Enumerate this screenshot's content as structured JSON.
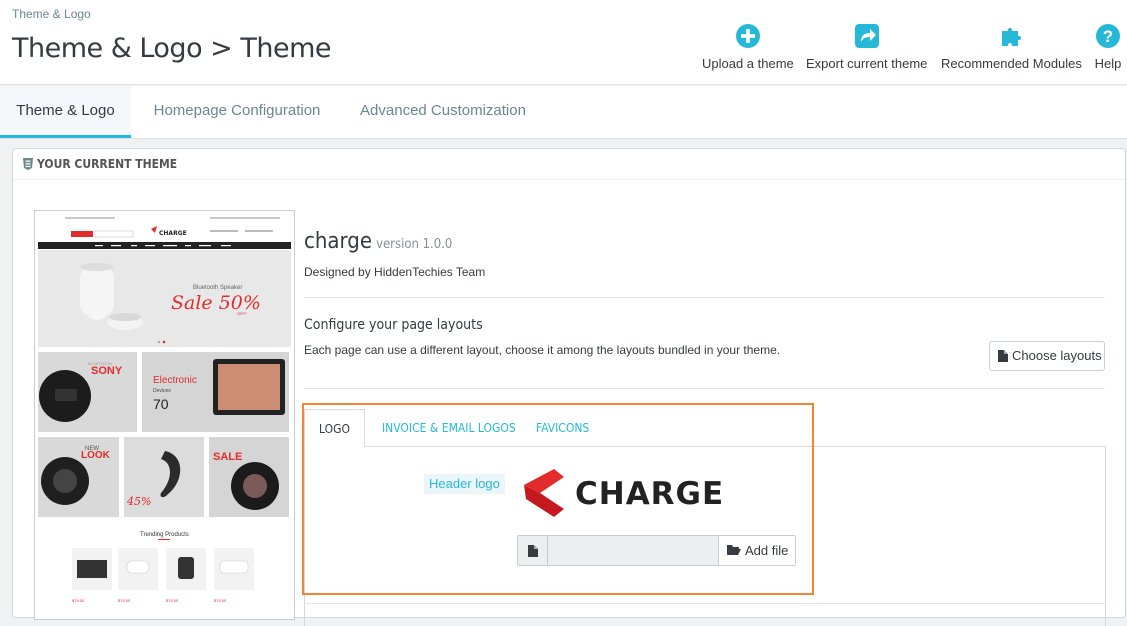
{
  "header": {
    "breadcrumb": "Theme & Logo",
    "title": "Theme & Logo > Theme",
    "toolbar": [
      {
        "label": "Upload a theme",
        "icon": "plus-circle-icon"
      },
      {
        "label": "Export current theme",
        "icon": "share-icon"
      },
      {
        "label": "Recommended Modules",
        "icon": "puzzle-icon"
      },
      {
        "label": "Help",
        "icon": "question-circle-icon"
      }
    ]
  },
  "tabs": [
    {
      "label": "Theme & Logo",
      "active": true
    },
    {
      "label": "Homepage Configuration",
      "active": false
    },
    {
      "label": "Advanced Customization",
      "active": false
    }
  ],
  "panel": {
    "heading": "YOUR CURRENT THEME",
    "theme": {
      "name": "charge",
      "version": "version 1.0.0",
      "designed_by": "Designed by HiddenTechies Team"
    },
    "layouts": {
      "title": "Configure your page layouts",
      "description": "Each page can use a different layout, choose it among the layouts bundled in your theme.",
      "button": "Choose layouts"
    },
    "logo_tabs": [
      {
        "label": "LOGO",
        "active": true
      },
      {
        "label": "INVOICE & EMAIL LOGOS",
        "active": false
      },
      {
        "label": "FAVICONS",
        "active": false
      }
    ],
    "header_logo_label": "Header logo",
    "logo_text": "CHARGE",
    "file_input": {
      "value": "",
      "button": "Add file"
    }
  },
  "preview": {
    "logo": "CHARGE",
    "hero_caption": "Bluetooth Speaker",
    "hero_sale": "Sale 50%",
    "hero_off": "OFF*",
    "tile1": "SONY",
    "tile1_sub": "BLUETOOTH",
    "tile2": "Electronic",
    "tile2_sub": "Devices",
    "tile2_pct": "70",
    "tile3": "NEW LOOK",
    "tile3_sub": "NEW YEARS COLLECTIONS",
    "tile4": "45%",
    "tile5": "SALE",
    "tile5_sub": "CAMERA",
    "trending": "Trending Products",
    "product_prices": [
      "$79.00",
      "$79.00",
      "$79.00",
      "$79.00"
    ]
  },
  "colors": {
    "accent": "#25b9d7",
    "highlight_border": "#f58534",
    "brand_red": "#e32b2b"
  }
}
